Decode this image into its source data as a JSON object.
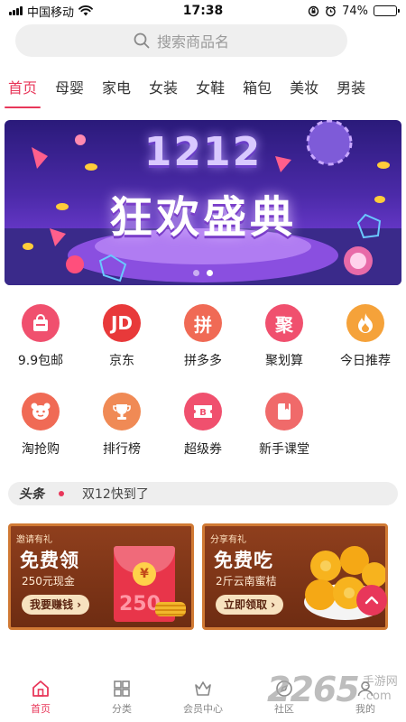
{
  "status_bar": {
    "carrier": "中国移动",
    "time": "17:38",
    "battery": "74%",
    "battery_level": 0.74
  },
  "search": {
    "placeholder": "搜索商品名"
  },
  "tabs": [
    {
      "label": "首页",
      "active": true
    },
    {
      "label": "母婴",
      "active": false
    },
    {
      "label": "家电",
      "active": false
    },
    {
      "label": "女装",
      "active": false
    },
    {
      "label": "女鞋",
      "active": false
    },
    {
      "label": "箱包",
      "active": false
    },
    {
      "label": "美妆",
      "active": false
    },
    {
      "label": "男装",
      "active": false
    }
  ],
  "banner": {
    "line1": "1212",
    "line2": "狂欢盛典",
    "page_count": 2,
    "active_page": 2
  },
  "grid_row1": [
    {
      "label": "9.9包邮",
      "icon": "shopping-bag-icon",
      "glyph": "",
      "color": "#f0506e"
    },
    {
      "label": "京东",
      "icon": "jd-logo-icon",
      "glyph": "JD",
      "color": "#e8393a"
    },
    {
      "label": "拼多多",
      "icon": "pinduoduo-logo-icon",
      "glyph": "拼",
      "color": "#f06a55"
    },
    {
      "label": "聚划算",
      "icon": "juhuasuan-logo-icon",
      "glyph": "聚",
      "color": "#f0506e"
    },
    {
      "label": "今日推荐",
      "icon": "flame-icon",
      "glyph": "",
      "color": "#f5a23a"
    }
  ],
  "grid_row2": [
    {
      "label": "淘抢购",
      "icon": "bear-icon",
      "glyph": "",
      "color": "#f06a55"
    },
    {
      "label": "排行榜",
      "icon": "trophy-icon",
      "glyph": "",
      "color": "#f08a55"
    },
    {
      "label": "超级券",
      "icon": "coupon-icon",
      "glyph": "",
      "color": "#f0506e"
    },
    {
      "label": "新手课堂",
      "icon": "book-icon",
      "glyph": "",
      "color": "#f06a6a"
    }
  ],
  "headline": {
    "tag": "头条",
    "text": "双12快到了"
  },
  "promo_left": {
    "tag": "邀请有礼",
    "title": "免费领",
    "subtitle": "250元现金",
    "button": "我要赚钱 ›",
    "envelope_coin": "¥",
    "envelope_amount": "250"
  },
  "promo_right": {
    "tag": "分享有礼",
    "title": "免费吃",
    "subtitle": "2斤云南蜜桔",
    "button": "立即领取 ›"
  },
  "bottom_nav": [
    {
      "label": "首页",
      "icon": "home-icon",
      "active": true
    },
    {
      "label": "分类",
      "icon": "grid-icon",
      "active": false
    },
    {
      "label": "会员中心",
      "icon": "crown-icon",
      "active": false
    },
    {
      "label": "社区",
      "icon": "compass-icon",
      "active": false
    },
    {
      "label": "我的",
      "icon": "person-icon",
      "active": false
    }
  ],
  "watermark": {
    "number": "2265",
    "text_line1": "手游网",
    "text_line2": ".com"
  },
  "colors": {
    "accent": "#e8375a",
    "banner_purple": "#6d3bd0",
    "promo_brown": "#8f3f1d"
  }
}
